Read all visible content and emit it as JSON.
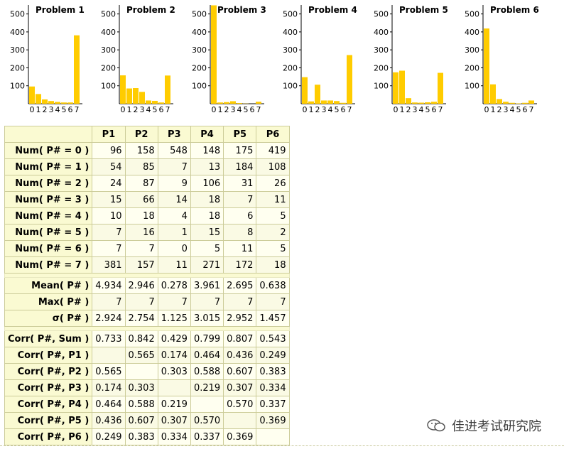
{
  "chart_data": [
    {
      "type": "bar",
      "title": "Problem 1",
      "categories": [
        "0",
        "1",
        "2",
        "3",
        "4",
        "5",
        "6",
        "7"
      ],
      "values": [
        96,
        54,
        24,
        15,
        10,
        7,
        7,
        381
      ],
      "yticks": [
        100,
        200,
        300,
        400,
        500
      ],
      "ylim": [
        0,
        550
      ],
      "color": "#ffcc00"
    },
    {
      "type": "bar",
      "title": "Problem 2",
      "categories": [
        "0",
        "1",
        "2",
        "3",
        "4",
        "5",
        "6",
        "7"
      ],
      "values": [
        158,
        85,
        87,
        66,
        18,
        16,
        7,
        157
      ],
      "yticks": [
        100,
        200,
        300,
        400,
        500
      ],
      "ylim": [
        0,
        550
      ],
      "color": "#ffcc00"
    },
    {
      "type": "bar",
      "title": "Problem 3",
      "categories": [
        "0",
        "1",
        "2",
        "3",
        "4",
        "5",
        "6",
        "7"
      ],
      "values": [
        548,
        7,
        9,
        14,
        4,
        1,
        0,
        11
      ],
      "yticks": [
        100,
        200,
        300,
        400,
        500
      ],
      "ylim": [
        0,
        550
      ],
      "color": "#ffcc00"
    },
    {
      "type": "bar",
      "title": "Problem 4",
      "categories": [
        "0",
        "1",
        "2",
        "3",
        "4",
        "5",
        "6",
        "7"
      ],
      "values": [
        148,
        13,
        106,
        18,
        18,
        15,
        5,
        271
      ],
      "yticks": [
        100,
        200,
        300,
        400,
        500
      ],
      "ylim": [
        0,
        550
      ],
      "color": "#ffcc00"
    },
    {
      "type": "bar",
      "title": "Problem 5",
      "categories": [
        "0",
        "1",
        "2",
        "3",
        "4",
        "5",
        "6",
        "7"
      ],
      "values": [
        175,
        184,
        31,
        7,
        6,
        8,
        11,
        172
      ],
      "yticks": [
        100,
        200,
        300,
        400,
        500
      ],
      "ylim": [
        0,
        550
      ],
      "color": "#ffcc00"
    },
    {
      "type": "bar",
      "title": "Problem 6",
      "categories": [
        "0",
        "1",
        "2",
        "3",
        "4",
        "5",
        "6",
        "7"
      ],
      "values": [
        419,
        108,
        26,
        11,
        5,
        2,
        5,
        18
      ],
      "yticks": [
        100,
        200,
        300,
        400,
        500
      ],
      "ylim": [
        0,
        550
      ],
      "color": "#ffcc00"
    }
  ],
  "table": {
    "columns": [
      "P1",
      "P2",
      "P3",
      "P4",
      "P5",
      "P6"
    ],
    "groups": [
      [
        {
          "label": "Num( P# = 0 )",
          "values": [
            "96",
            "158",
            "548",
            "148",
            "175",
            "419"
          ]
        },
        {
          "label": "Num( P# = 1 )",
          "values": [
            "54",
            "85",
            "7",
            "13",
            "184",
            "108"
          ]
        },
        {
          "label": "Num( P# = 2 )",
          "values": [
            "24",
            "87",
            "9",
            "106",
            "31",
            "26"
          ]
        },
        {
          "label": "Num( P# = 3 )",
          "values": [
            "15",
            "66",
            "14",
            "18",
            "7",
            "11"
          ]
        },
        {
          "label": "Num( P# = 4 )",
          "values": [
            "10",
            "18",
            "4",
            "18",
            "6",
            "5"
          ]
        },
        {
          "label": "Num( P# = 5 )",
          "values": [
            "7",
            "16",
            "1",
            "15",
            "8",
            "2"
          ]
        },
        {
          "label": "Num( P# = 6 )",
          "values": [
            "7",
            "7",
            "0",
            "5",
            "11",
            "5"
          ]
        },
        {
          "label": "Num( P# = 7 )",
          "values": [
            "381",
            "157",
            "11",
            "271",
            "172",
            "18"
          ]
        }
      ],
      [
        {
          "label": "Mean( P# )",
          "values": [
            "4.934",
            "2.946",
            "0.278",
            "3.961",
            "2.695",
            "0.638"
          ]
        },
        {
          "label": "Max( P# )",
          "values": [
            "7",
            "7",
            "7",
            "7",
            "7",
            "7"
          ]
        },
        {
          "label": "σ( P# )",
          "values": [
            "2.924",
            "2.754",
            "1.125",
            "3.015",
            "2.952",
            "1.457"
          ]
        }
      ],
      [
        {
          "label": "Corr( P#, Sum )",
          "values": [
            "0.733",
            "0.842",
            "0.429",
            "0.799",
            "0.807",
            "0.543"
          ]
        },
        {
          "label": "Corr( P#, P1 )",
          "values": [
            "",
            "0.565",
            "0.174",
            "0.464",
            "0.436",
            "0.249"
          ]
        },
        {
          "label": "Corr( P#, P2 )",
          "values": [
            "0.565",
            "",
            "0.303",
            "0.588",
            "0.607",
            "0.383"
          ]
        },
        {
          "label": "Corr( P#, P3 )",
          "values": [
            "0.174",
            "0.303",
            "",
            "0.219",
            "0.307",
            "0.334"
          ]
        },
        {
          "label": "Corr( P#, P4 )",
          "values": [
            "0.464",
            "0.588",
            "0.219",
            "",
            "0.570",
            "0.337"
          ]
        },
        {
          "label": "Corr( P#, P5 )",
          "values": [
            "0.436",
            "0.607",
            "0.307",
            "0.570",
            "",
            "0.369"
          ]
        },
        {
          "label": "Corr( P#, P6 )",
          "values": [
            "0.249",
            "0.383",
            "0.334",
            "0.337",
            "0.369",
            ""
          ]
        }
      ]
    ]
  },
  "watermark": {
    "text": "佳进考试研究院",
    "icon": "wechat-icon"
  }
}
